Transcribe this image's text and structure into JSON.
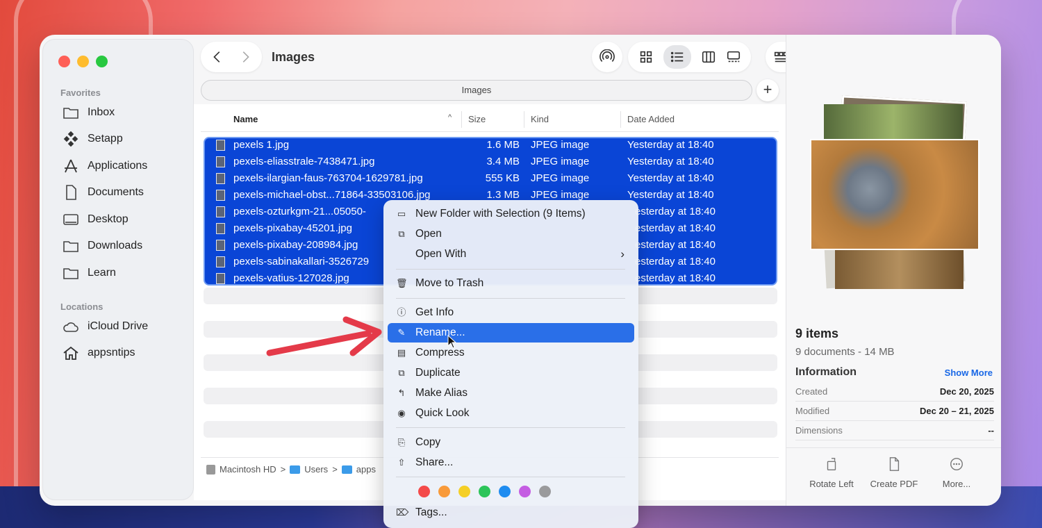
{
  "window": {
    "title": "Images",
    "path_field": "Images"
  },
  "sidebar": {
    "favorites_label": "Favorites",
    "favorites": [
      {
        "label": "Inbox",
        "icon": "folder-icon"
      },
      {
        "label": "Setapp",
        "icon": "setapp-icon"
      },
      {
        "label": "Applications",
        "icon": "applications-icon"
      },
      {
        "label": "Documents",
        "icon": "document-icon"
      },
      {
        "label": "Desktop",
        "icon": "desktop-icon"
      },
      {
        "label": "Downloads",
        "icon": "folder-icon"
      },
      {
        "label": "Learn",
        "icon": "folder-icon"
      }
    ],
    "locations_label": "Locations",
    "locations": [
      {
        "label": "iCloud Drive",
        "icon": "cloud-icon"
      },
      {
        "label": "appsntips",
        "icon": "home-icon"
      }
    ]
  },
  "columns": {
    "name": "Name",
    "size": "Size",
    "kind": "Kind",
    "date": "Date Added"
  },
  "files": [
    {
      "name": "pexels 1.jpg",
      "size": "1.6 MB",
      "kind": "JPEG image",
      "date": "Yesterday at 18:40"
    },
    {
      "name": "pexels-eliasstrale-7438471.jpg",
      "size": "3.4 MB",
      "kind": "JPEG image",
      "date": "Yesterday at 18:40"
    },
    {
      "name": "pexels-ilargian-faus-763704-1629781.jpg",
      "size": "555 KB",
      "kind": "JPEG image",
      "date": "Yesterday at 18:40"
    },
    {
      "name": "pexels-michael-obst...71864-33503106.jpg",
      "size": "1.3 MB",
      "kind": "JPEG image",
      "date": "Yesterday at 18:40"
    },
    {
      "name": "pexels-ozturkgm-21...05050-",
      "size": "",
      "kind": "",
      "date": "esterday at 18:40"
    },
    {
      "name": "pexels-pixabay-45201.jpg",
      "size": "",
      "kind": "",
      "date": "esterday at 18:40"
    },
    {
      "name": "pexels-pixabay-208984.jpg",
      "size": "",
      "kind": "",
      "date": "esterday at 18:40"
    },
    {
      "name": "pexels-sabinakallari-3526729",
      "size": "",
      "kind": "",
      "date": "esterday at 18:40"
    },
    {
      "name": "pexels-vatius-127028.jpg",
      "size": "",
      "kind": "",
      "date": "esterday at 18:40"
    }
  ],
  "breadcrumb": {
    "disk": "Macintosh HD",
    "sep": ">",
    "users": "Users",
    "user": "apps"
  },
  "preview": {
    "count": "9 items",
    "subtitle": "9 documents - 14 MB",
    "info_label": "Information",
    "show_more": "Show More",
    "created_label": "Created",
    "created_value": "Dec 20, 2025",
    "modified_label": "Modified",
    "modified_value": "Dec 20 – 21, 2025",
    "dimensions_label": "Dimensions",
    "dimensions_value": "--",
    "actions": {
      "rotate": "Rotate Left",
      "pdf": "Create PDF",
      "more": "More..."
    }
  },
  "menu": {
    "new_folder": "New Folder with Selection (9 Items)",
    "open": "Open",
    "open_with": "Open With",
    "trash": "Move to Trash",
    "get_info": "Get Info",
    "rename": "Rename...",
    "compress": "Compress",
    "duplicate": "Duplicate",
    "alias": "Make Alias",
    "quick_look": "Quick Look",
    "copy": "Copy",
    "share": "Share...",
    "tags": "Tags...",
    "tag_colors": [
      "#f44a4a",
      "#f89a3a",
      "#f5cf26",
      "#2cc459",
      "#1f8cf0",
      "#c45de2",
      "#9a9a9c"
    ]
  },
  "colors": {
    "selection": "#0a45d6",
    "highlight": "#2a6fe8",
    "arrow": "#e43a49"
  }
}
